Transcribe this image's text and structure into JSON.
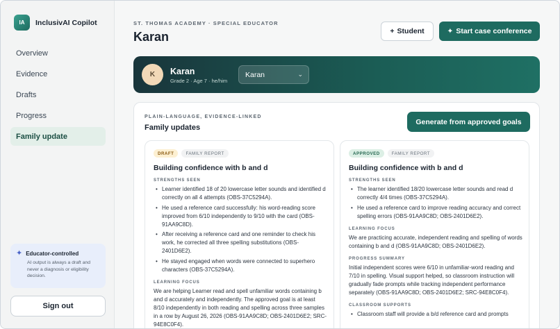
{
  "app": {
    "logo_text": "IA",
    "name": "InclusivAI Copilot"
  },
  "sidebar": {
    "items": [
      {
        "label": "Overview"
      },
      {
        "label": "Evidence"
      },
      {
        "label": "Drafts"
      },
      {
        "label": "Progress"
      },
      {
        "label": "Family update",
        "active": true
      }
    ],
    "educator_card": {
      "title": "Educator-controlled",
      "text": "AI output is always a draft and never a diagnosis or eligibility decision.",
      "icon": "sparkle-icon"
    },
    "signout_label": "Sign out"
  },
  "header": {
    "eyebrow": "ST. THOMAS ACADEMY · SPECIAL EDUCATOR",
    "title": "Karan",
    "student_button": "Student",
    "student_button_icon": "+",
    "conference_button": "Start case conference",
    "conference_button_icon": "✦"
  },
  "student": {
    "initial": "K",
    "name": "Karan",
    "meta": "Grade 2 · Age 7 · he/him",
    "selected": "Karan"
  },
  "family_updates": {
    "eyebrow": "PLAIN-LANGUAGE, EVIDENCE-LINKED",
    "title": "Family updates",
    "generate_button": "Generate from approved goals",
    "reports": [
      {
        "status": "DRAFT",
        "kind": "FAMILY REPORT",
        "title": "Building confidence with b and d",
        "strengths_label": "STRENGTHS SEEN",
        "strengths": [
          "Learner identified 18 of 20 lowercase letter sounds and identified d correctly on all 4 attempts (OBS-37C5294A).",
          "He used a reference card successfully: his word-reading score improved from 6/10 independently to 9/10 with the card (OBS-91AA9C8D).",
          "After receiving a reference card and one reminder to check his work, he corrected all three spelling substitutions (OBS-2401D6E2).",
          "He stayed engaged when words were connected to superhero characters (OBS-37C5294A)."
        ],
        "focus_label": "LEARNING FOCUS",
        "focus": "We are helping Learner read and spell unfamiliar words containing b and d accurately and independently. The approved goal is at least 8/10 independently in both reading and spelling across three samples in a row by August 26, 2026 (OBS-91AA9C8D; OBS-2401D6E2; SRC-94E8C0F4)."
      },
      {
        "status": "APPROVED",
        "kind": "FAMILY REPORT",
        "title": "Building confidence with b and d",
        "strengths_label": "STRENGTHS SEEN",
        "strengths": [
          "The learner identified 18/20 lowercase letter sounds and read d correctly 4/4 times (OBS-37C5294A).",
          "He used a reference card to improve reading accuracy and correct spelling errors (OBS-91AA9C8D; OBS-2401D6E2)."
        ],
        "focus_label": "LEARNING FOCUS",
        "focus": "We are practicing accurate, independent reading and spelling of words containing b and d (OBS-91AA9C8D; OBS-2401D6E2).",
        "progress_label": "PROGRESS SUMMARY",
        "progress": "Initial independent scores were 6/10 in unfamiliar-word reading and 7/10 in spelling. Visual support helped, so classroom instruction will gradually fade prompts while tracking independent performance separately (OBS-91AA9C8D; OBS-2401D6E2; SRC-94E8C0F4).",
        "supports_label": "CLASSROOM SUPPORTS",
        "supports": "Classroom staff will provide a b/d reference card and prompts"
      }
    ]
  },
  "colors": {
    "accent": "#1e6b60",
    "banner_dark": "#19353b",
    "draft_chip": "#fdf0d2",
    "approved_chip": "#dcefe5",
    "educator_card": "#e8eefb"
  }
}
